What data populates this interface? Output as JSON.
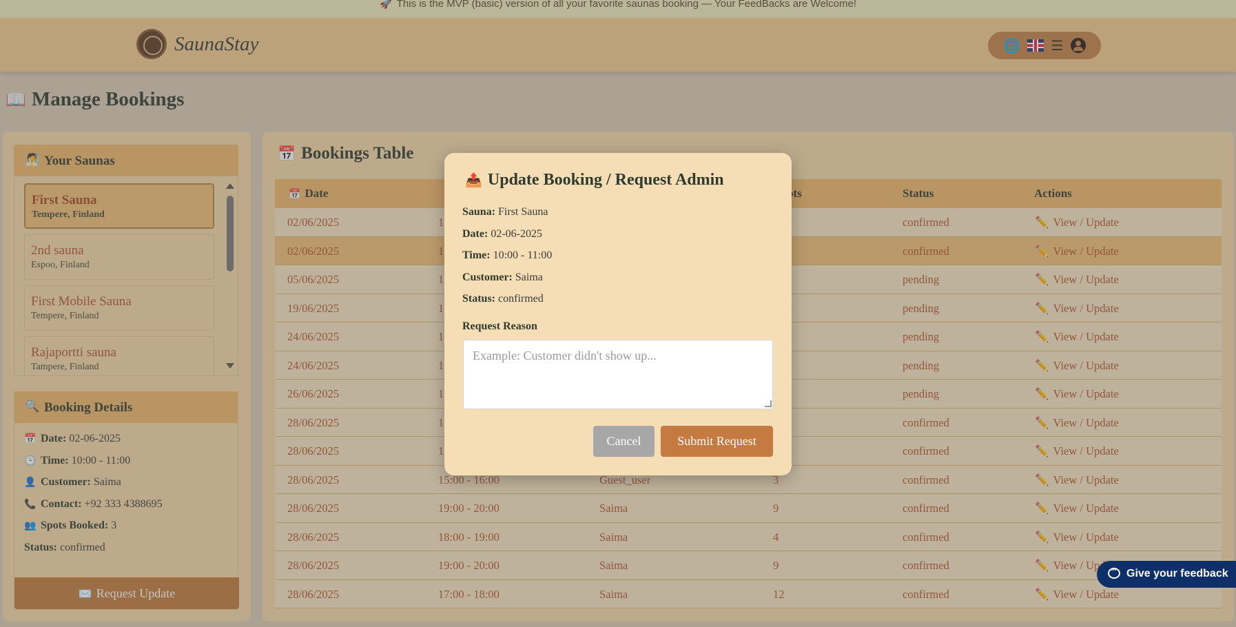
{
  "announcement": {
    "icon": "rocket-icon",
    "glyph": "🚀",
    "text": "This is the MVP (basic) version of all your favorite saunas booking — Your FeedBacks are Welcome!"
  },
  "header": {
    "brand": "SaunaStay",
    "icons": [
      "globe-icon",
      "uk-flag-icon",
      "menu-icon",
      "user-icon"
    ]
  },
  "page": {
    "title": "Manage Bookings",
    "title_icon": "book-icon"
  },
  "saunas": {
    "title": "Your Saunas",
    "items": [
      {
        "name": "First Sauna",
        "location": "Tempere, Finland",
        "active": true
      },
      {
        "name": "2nd sauna",
        "location": "Espoo, Finland",
        "active": false
      },
      {
        "name": "First Mobile Sauna",
        "location": "Tempere, Finland",
        "active": false
      },
      {
        "name": "Rajaportti sauna",
        "location": "Tampere, Finland",
        "active": false
      }
    ]
  },
  "booking_details": {
    "title": "Booking Details",
    "date_label": "Date:",
    "date": "02-06-2025",
    "time_label": "Time:",
    "time": "10:00 - 11:00",
    "customer_label": "Customer:",
    "customer": "Saima",
    "contact_label": "Contact:",
    "contact": "+92 333 4388695",
    "spots_label": "Spots Booked:",
    "spots": "3",
    "status_label": "Status:",
    "status": "confirmed",
    "request_button": "Request Update"
  },
  "table": {
    "title": "Bookings Table",
    "headers": {
      "date": "Date",
      "spots": "Spots",
      "status": "Status",
      "actions": "Actions"
    },
    "action_label": "View / Update",
    "rows": [
      {
        "date": "02/06/2025",
        "time": "1",
        "customer": "",
        "spots": "",
        "status": "confirmed"
      },
      {
        "date": "02/06/2025",
        "time": "1",
        "customer": "",
        "spots": "",
        "status": "confirmed"
      },
      {
        "date": "05/06/2025",
        "time": "1",
        "customer": "",
        "spots": "",
        "status": "pending"
      },
      {
        "date": "19/06/2025",
        "time": "1",
        "customer": "",
        "spots": "",
        "status": "pending"
      },
      {
        "date": "24/06/2025",
        "time": "1",
        "customer": "",
        "spots": "",
        "status": "pending"
      },
      {
        "date": "24/06/2025",
        "time": "1",
        "customer": "",
        "spots": "",
        "status": "pending"
      },
      {
        "date": "26/06/2025",
        "time": "1",
        "customer": "",
        "spots": "",
        "status": "pending"
      },
      {
        "date": "28/06/2025",
        "time": "1",
        "customer": "",
        "spots": "",
        "status": "confirmed"
      },
      {
        "date": "28/06/2025",
        "time": "1",
        "customer": "",
        "spots": "",
        "status": "confirmed"
      },
      {
        "date": "28/06/2025",
        "time": "15:00 - 16:00",
        "customer": "Guest_user",
        "spots": "3",
        "status": "confirmed"
      },
      {
        "date": "28/06/2025",
        "time": "19:00 - 20:00",
        "customer": "Saima",
        "spots": "9",
        "status": "confirmed"
      },
      {
        "date": "28/06/2025",
        "time": "18:00 - 19:00",
        "customer": "Saima",
        "spots": "4",
        "status": "confirmed"
      },
      {
        "date": "28/06/2025",
        "time": "19:00 - 20:00",
        "customer": "Saima",
        "spots": "9",
        "status": "confirmed"
      },
      {
        "date": "28/06/2025",
        "time": "17:00 - 18:00",
        "customer": "Saima",
        "spots": "12",
        "status": "confirmed"
      }
    ]
  },
  "modal": {
    "title": "Update Booking / Request Admin",
    "title_icon": "inbox-upload-icon",
    "sauna_label": "Sauna:",
    "sauna": "First Sauna",
    "date_label": "Date:",
    "date": "02-06-2025",
    "time_label": "Time:",
    "time": "10:00 - 11:00",
    "customer_label": "Customer:",
    "customer": "Saima",
    "status_label": "Status:",
    "status": "confirmed",
    "reason_label": "Request Reason",
    "reason_placeholder": "Example: Customer didn't show up...",
    "reason_value": "",
    "cancel": "Cancel",
    "submit": "Submit Request"
  },
  "feedback_button": "Give your feedback"
}
